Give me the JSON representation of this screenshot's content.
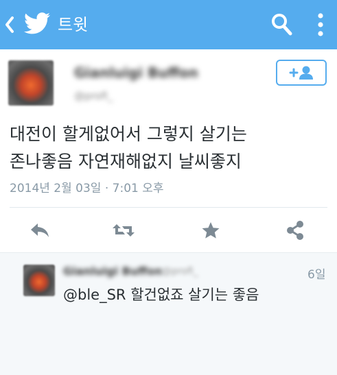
{
  "header": {
    "title": "트윗",
    "bg_color": "#55acee",
    "icons": [
      "back-icon",
      "twitter-bird-icon",
      "search-icon",
      "more-vertical-icon"
    ]
  },
  "tweet": {
    "author_name": "Gianluigi Buffon",
    "author_handle": "@profi_",
    "text_lines": [
      "대전이 할게없어서 그렇지 살기는",
      "존나좋음 자연재해없지 날씨좋지"
    ],
    "timestamp": "2014년 2월 03일 · 7:01 오후",
    "follow_icon": "add-user-icon",
    "actions": [
      "reply-icon",
      "retweet-icon",
      "favorite-icon",
      "share-icon"
    ]
  },
  "reply": {
    "author_name": "Gianluigi Buffon",
    "author_handle": "@profi_",
    "time": "6일",
    "mention": "@ble_SR",
    "text": "할건없죠 살기는 좋음"
  },
  "colors": {
    "accent": "#55acee",
    "icon_gray": "#7d8a94",
    "muted": "#8899a6"
  }
}
